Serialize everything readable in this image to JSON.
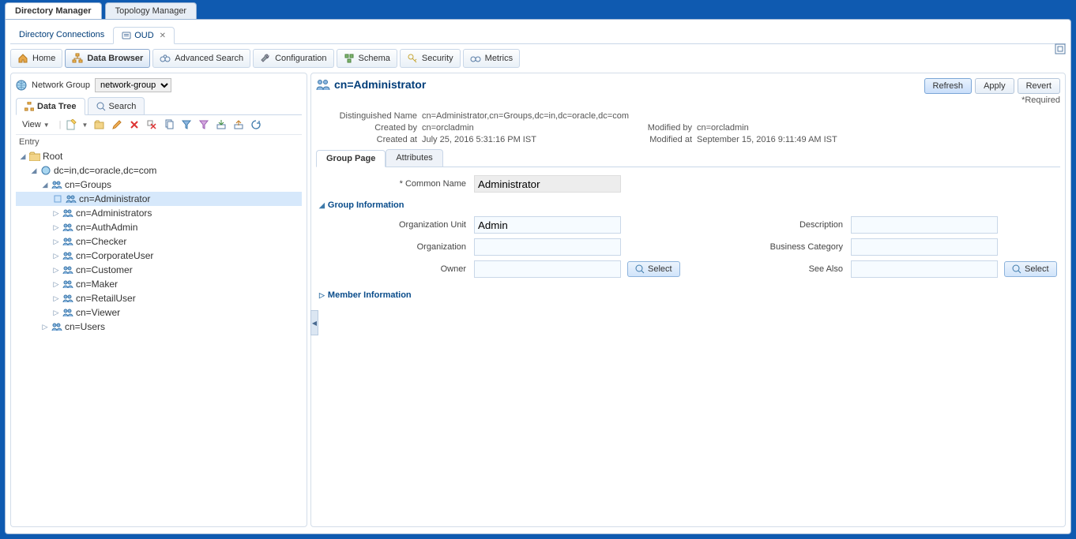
{
  "topTabs": {
    "directory": "Directory Manager",
    "topology": "Topology Manager"
  },
  "connTabs": {
    "connections": "Directory Connections",
    "oud": "OUD"
  },
  "toolbar": {
    "home": "Home",
    "browser": "Data Browser",
    "advanced": "Advanced Search",
    "config": "Configuration",
    "schema": "Schema",
    "security": "Security",
    "metrics": "Metrics"
  },
  "networkGroup": {
    "label": "Network Group",
    "value": "network-group"
  },
  "subTabs": {
    "dataTree": "Data Tree",
    "search": "Search"
  },
  "viewBtn": "View",
  "entryHeader": "Entry",
  "tree": {
    "root": "Root",
    "dc": "dc=in,dc=oracle,dc=com",
    "groups": "cn=Groups",
    "items": [
      "cn=Administrator",
      "cn=Administrators",
      "cn=AuthAdmin",
      "cn=Checker",
      "cn=CorporateUser",
      "cn=Customer",
      "cn=Maker",
      "cn=RetailUser",
      "cn=Viewer"
    ],
    "users": "cn=Users"
  },
  "detail": {
    "title": "cn=Administrator",
    "buttons": {
      "refresh": "Refresh",
      "apply": "Apply",
      "revert": "Revert"
    },
    "required": "*Required",
    "meta": {
      "dnLabel": "Distinguished Name",
      "dn": "cn=Administrator,cn=Groups,dc=in,dc=oracle,dc=com",
      "createdByLabel": "Created by",
      "createdBy": "cn=orcladmin",
      "modifiedByLabel": "Modified by",
      "modifiedBy": "cn=orcladmin",
      "createdAtLabel": "Created at",
      "createdAt": "July 25, 2016 5:31:16 PM IST",
      "modifiedAtLabel": "Modified at",
      "modifiedAt": "September 15, 2016 9:11:49 AM IST"
    },
    "tabs": {
      "group": "Group Page",
      "attrs": "Attributes"
    },
    "fields": {
      "commonNameLabel": "* Common Name",
      "commonName": "Administrator",
      "groupInfo": "Group Information",
      "orgUnitLabel": "Organization Unit",
      "orgUnit": "Admin",
      "orgLabel": "Organization",
      "org": "",
      "ownerLabel": "Owner",
      "owner": "",
      "descLabel": "Description",
      "desc": "",
      "bizCatLabel": "Business Category",
      "bizCat": "",
      "seeAlsoLabel": "See Also",
      "seeAlso": "",
      "select": "Select",
      "memberInfo": "Member Information"
    }
  }
}
